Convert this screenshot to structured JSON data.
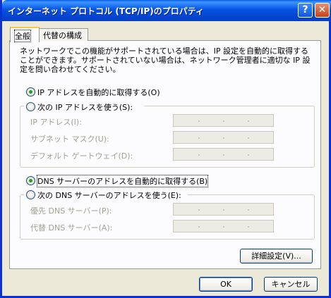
{
  "window": {
    "title": "インターネット プロトコル (TCP/IP)のプロパティ",
    "help_glyph": "?",
    "close_glyph": "✕"
  },
  "tabs": [
    {
      "label": "全般"
    },
    {
      "label": "代替の構成"
    }
  ],
  "description": "ネットワークでこの機能がサポートされている場合は、IP 設定を自動的に取得することができます。サポートされていない場合は、ネットワーク管理者に適切な IP 設定を問い合わせてください。",
  "ip": {
    "auto_label": "IP アドレスを自動的に取得する(O)",
    "manual_label": "次の IP アドレスを使う(S):",
    "fields": [
      {
        "label": "IP アドレス(I):"
      },
      {
        "label": "サブネット マスク(U):"
      },
      {
        "label": "デフォルト ゲートウェイ(D):"
      }
    ]
  },
  "dns": {
    "auto_label": "DNS サーバーのアドレスを自動的に取得する(B)",
    "manual_label": "次の DNS サーバーのアドレスを使う(E):",
    "fields": [
      {
        "label": "優先 DNS サーバー(P):"
      },
      {
        "label": "代替 DNS サーバー(A):"
      }
    ]
  },
  "buttons": {
    "advanced": "詳細設定(V)...",
    "ok": "OK",
    "cancel": "キャンセル"
  }
}
